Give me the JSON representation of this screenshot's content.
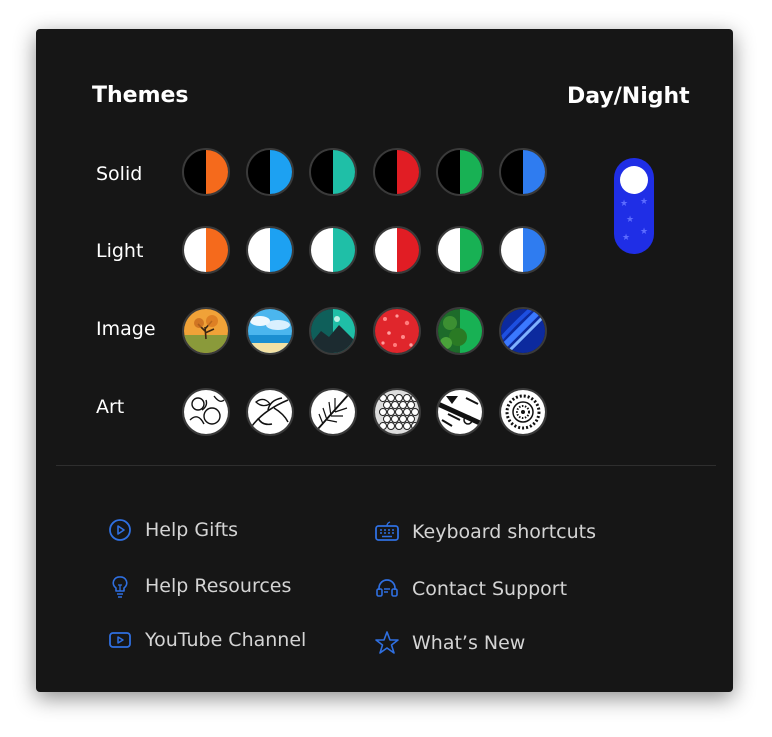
{
  "themes": {
    "title": "Themes",
    "rows": [
      {
        "label": "Solid",
        "swatches": [
          {
            "name": "solid-orange",
            "color": "#f56a1c"
          },
          {
            "name": "solid-blue",
            "color": "#1da1f2"
          },
          {
            "name": "solid-teal",
            "color": "#1fbfa7"
          },
          {
            "name": "solid-red",
            "color": "#e11d24"
          },
          {
            "name": "solid-green",
            "color": "#18b154"
          },
          {
            "name": "solid-royal-blue",
            "color": "#2f7cf0"
          }
        ]
      },
      {
        "label": "Light",
        "swatches": [
          {
            "name": "light-orange",
            "color": "#f56a1c"
          },
          {
            "name": "light-blue",
            "color": "#1da1f2"
          },
          {
            "name": "light-teal",
            "color": "#1fbfa7"
          },
          {
            "name": "light-red",
            "color": "#e11d24"
          },
          {
            "name": "light-green",
            "color": "#18b154"
          },
          {
            "name": "light-royal-blue",
            "color": "#2f7cf0"
          }
        ]
      },
      {
        "label": "Image",
        "swatches": [
          {
            "name": "image-autumn-tree",
            "color": "#e89a2e"
          },
          {
            "name": "image-beach",
            "color": "#37a9e8"
          },
          {
            "name": "image-mountain",
            "color": "#1fbfa7"
          },
          {
            "name": "image-red-texture",
            "color": "#e11d24"
          },
          {
            "name": "image-forest",
            "color": "#18b154"
          },
          {
            "name": "image-blue-abstract",
            "color": "#2f7cf0"
          }
        ]
      },
      {
        "label": "Art",
        "swatches": [
          {
            "name": "art-floral",
            "color": "#ffffff"
          },
          {
            "name": "art-leaves",
            "color": "#ffffff"
          },
          {
            "name": "art-feather",
            "color": "#ffffff"
          },
          {
            "name": "art-hexagons",
            "color": "#ffffff"
          },
          {
            "name": "art-tribal",
            "color": "#ffffff"
          },
          {
            "name": "art-mandala",
            "color": "#ffffff"
          }
        ]
      }
    ]
  },
  "day_night": {
    "title": "Day/Night",
    "toggle_color": "#1f2ee6",
    "state": "night"
  },
  "links": {
    "help_gifts": {
      "label": "Help Gifts",
      "icon": "play-circle-icon"
    },
    "help_resources": {
      "label": "Help Resources",
      "icon": "lightbulb-icon"
    },
    "youtube_channel": {
      "label": "YouTube Channel",
      "icon": "youtube-icon"
    },
    "keyboard_shortcuts": {
      "label": "Keyboard shortcuts",
      "icon": "keyboard-icon"
    },
    "contact_support": {
      "label": "Contact Support",
      "icon": "headset-icon"
    },
    "whats_new": {
      "label": "What’s New",
      "icon": "star-outline-icon"
    },
    "icon_color": "#2f6fe0"
  }
}
